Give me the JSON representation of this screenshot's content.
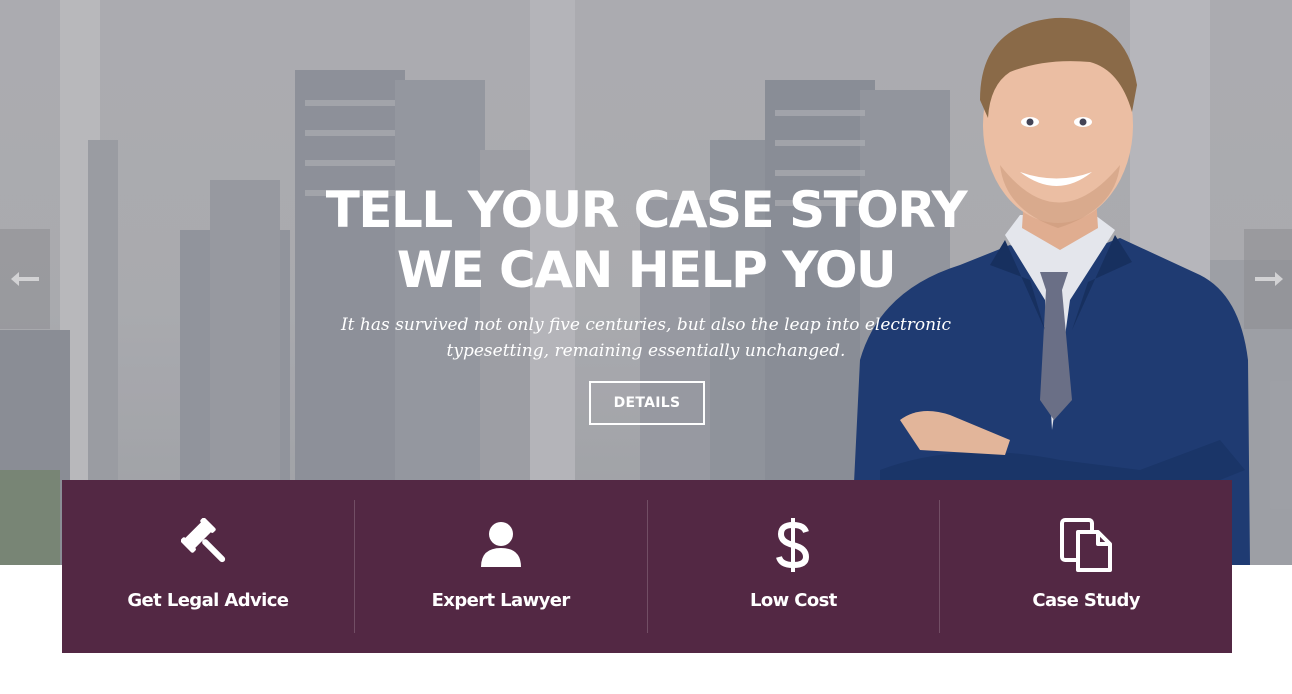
{
  "hero": {
    "title": "TELL YOUR CASE STORY WE CAN HELP YOU",
    "subtitle": "It has survived not only five centuries, but also the leap into electronic typesetting, remaining essentially unchanged.",
    "button_label": "DETAILS",
    "prev_icon": "arrow-left-icon",
    "next_icon": "arrow-right-icon"
  },
  "features": [
    {
      "label": "Get Legal Advice",
      "icon": "gavel-icon"
    },
    {
      "label": "Expert Lawyer",
      "icon": "user-icon"
    },
    {
      "label": "Low Cost",
      "icon": "dollar-icon"
    },
    {
      "label": "Case Study",
      "icon": "documents-icon"
    }
  ],
  "colors": {
    "feature_bar": "#532844",
    "text": "#ffffff",
    "suit": "#1f3b72"
  }
}
